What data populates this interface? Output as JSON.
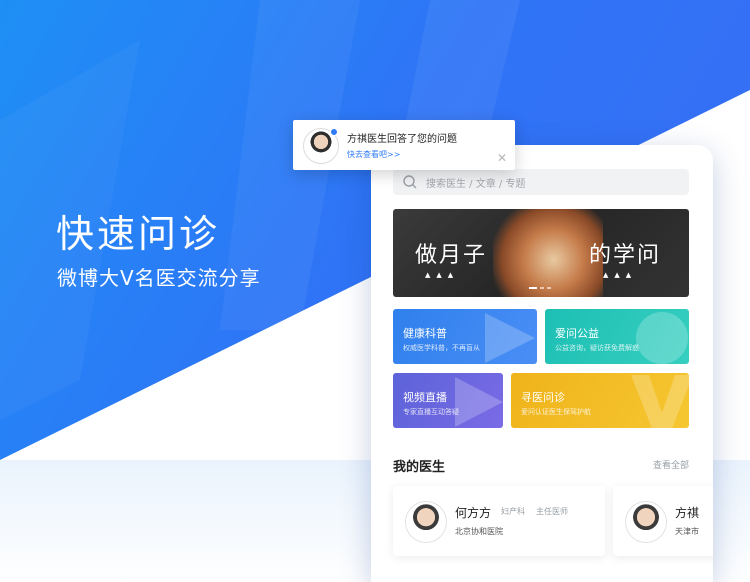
{
  "hero": {
    "title": "快速问诊",
    "subtitle": "微博大V名医交流分享"
  },
  "notification": {
    "message": "方祺医生回答了您的问题",
    "link": "快去查看吧>>",
    "close": "✕"
  },
  "search": {
    "placeholder": "搜索医生 / 文章 / 专题",
    "icon": "search-icon"
  },
  "banner": {
    "left_text": "做月子",
    "right_text": "的学问",
    "triangles": "▲▲▲"
  },
  "categories": [
    {
      "title": "健康科普",
      "subtitle": "权威医学科普，不再盲从"
    },
    {
      "title": "爱问公益",
      "subtitle": "公益咨询，疑访获免费解惑"
    },
    {
      "title": "视频直播",
      "subtitle": "专家直播互动答疑"
    },
    {
      "title": "寻医问诊",
      "subtitle": "爱问认证医生保驾护航"
    }
  ],
  "my_doctors": {
    "title": "我的医生",
    "more": "查看全部",
    "list": [
      {
        "name": "何方方",
        "department": "妇产科",
        "title": "主任医师",
        "hospital": "北京协和医院"
      },
      {
        "name": "方祺",
        "department": "",
        "title": "",
        "hospital": "天津市"
      }
    ]
  },
  "colors": {
    "primary": "#2f7cf6",
    "science": "#2f80ed",
    "charity": "#1dbfb4",
    "video": "#5c63d8",
    "consult": "#f0b31b"
  }
}
